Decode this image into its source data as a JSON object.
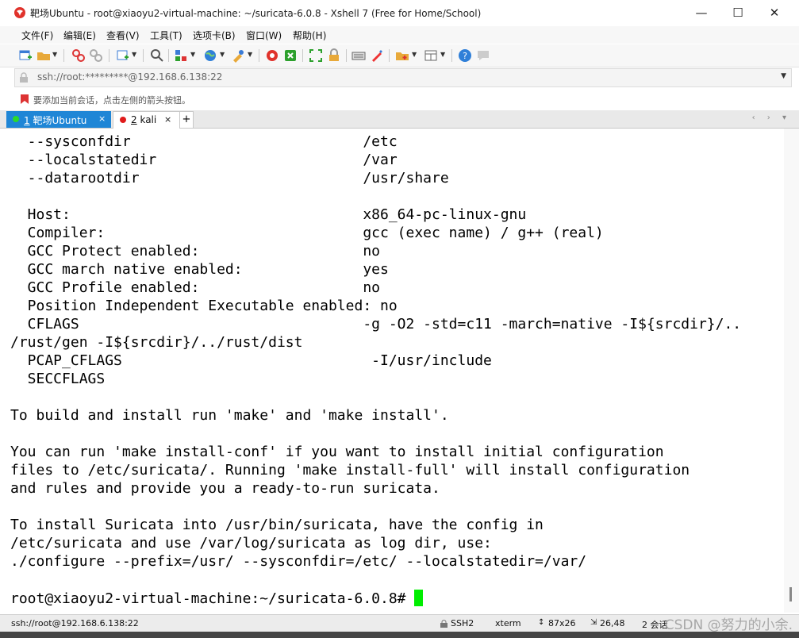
{
  "window": {
    "title": "靶场Ubuntu - root@xiaoyu2-virtual-machine: ~/suricata-6.0.8 - Xshell 7 (Free for Home/School)",
    "minimize_glyph": "—",
    "maximize_glyph": "☐",
    "close_glyph": "✕"
  },
  "menu": [
    "文件(F)",
    "编辑(E)",
    "查看(V)",
    "工具(T)",
    "选项卡(B)",
    "窗口(W)",
    "帮助(H)"
  ],
  "toolbar_icons": [
    "new-session-icon",
    "open-folder-icon",
    "connect-icon",
    "disconnect-icon",
    "new-window-icon",
    "find-icon",
    "session-props-icon",
    "globe-icon",
    "color-scheme-icon",
    "xftp-icon",
    "xmanager-icon",
    "fullscreen-icon",
    "lock-icon",
    "keyboard-icon",
    "highlight-icon",
    "add-session-icon",
    "layout-icon",
    "help-icon",
    "chat-icon"
  ],
  "address": {
    "value": "ssh://root:*********@192.168.6.138:22"
  },
  "hint": "要添加当前会话，点击左侧的箭头按钮。",
  "tabs": [
    {
      "num": "1",
      "name": "靶场Ubuntu",
      "active": true,
      "close": "×"
    },
    {
      "num": "2",
      "name": "kali",
      "active": false,
      "close": "×"
    }
  ],
  "tab_add": "+",
  "tab_nav": "‹ › ▾",
  "terminal": {
    "lines": [
      "  --sysconfdir                           /etc",
      "  --localstatedir                        /var",
      "  --datarootdir                          /usr/share",
      "",
      "  Host:                                  x86_64-pc-linux-gnu",
      "  Compiler:                              gcc (exec name) / g++ (real)",
      "  GCC Protect enabled:                   no",
      "  GCC march native enabled:              yes",
      "  GCC Profile enabled:                   no",
      "  Position Independent Executable enabled: no",
      "  CFLAGS                                 -g -O2 -std=c11 -march=native -I${srcdir}/..",
      "/rust/gen -I${srcdir}/../rust/dist",
      "  PCAP_CFLAGS                             -I/usr/include",
      "  SECCFLAGS",
      "",
      "To build and install run 'make' and 'make install'.",
      "",
      "You can run 'make install-conf' if you want to install initial configuration",
      "files to /etc/suricata/. Running 'make install-full' will install configuration",
      "and rules and provide you a ready-to-run suricata.",
      "",
      "To install Suricata into /usr/bin/suricata, have the config in",
      "/etc/suricata and use /var/log/suricata as log dir, use:",
      "./configure --prefix=/usr/ --sysconfdir=/etc/ --localstatedir=/var/",
      ""
    ],
    "prompt": "root@xiaoyu2-virtual-machine:~/suricata-6.0.8# "
  },
  "status": {
    "connection": "ssh://root@192.168.6.138:22",
    "protocol": "SSH2",
    "term": "xterm",
    "size": "87x26",
    "cursor_pos": "26,48",
    "sessions": "2 会话"
  },
  "watermark": "CSDN @努力的小余."
}
